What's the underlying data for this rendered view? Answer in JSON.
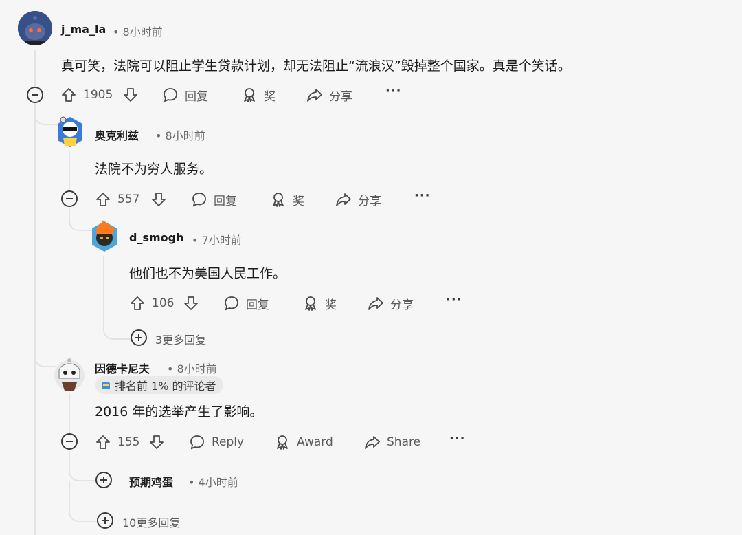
{
  "comments": {
    "c1": {
      "username": "j_ma_la",
      "time": "• 8小时前",
      "body": "真可笑，法院可以阻止学生贷款计划，却无法阻止“流浪汉”毁掉整个国家。真是个笑话。",
      "votes": "1905",
      "reply_label": "回复",
      "award_label": "奖",
      "share_label": "分享"
    },
    "c2": {
      "username": "奥克利兹",
      "time": "• 8小时前",
      "body": "法院不为穷人服务。",
      "votes": "557",
      "reply_label": "回复",
      "award_label": "奖",
      "share_label": "分享"
    },
    "c3": {
      "username": "d_smogh",
      "time": "• 7小时前",
      "body": "他们也不为美国人民工作。",
      "votes": "106",
      "reply_label": "回复",
      "award_label": "奖",
      "share_label": "分享",
      "more_replies": "3更多回复"
    },
    "c4": {
      "username": "因德卡尼夫",
      "time": "• 8小时前",
      "badge": "排名前 1% 的评论者",
      "body": "2016 年的选举产生了影响。",
      "votes": "155",
      "reply_label": "Reply",
      "award_label": "Award",
      "share_label": "Share"
    },
    "c5": {
      "username": "预期鸡蛋",
      "time": "• 4小时前"
    },
    "more_replies_bottom": "10更多回复"
  },
  "icons": {
    "upvote": "upvote-arrow-icon",
    "downvote": "downvote-arrow-icon",
    "reply": "speech-bubble-icon",
    "award": "award-ribbon-icon",
    "share": "share-arrow-icon",
    "overflow": "ellipsis-icon"
  }
}
